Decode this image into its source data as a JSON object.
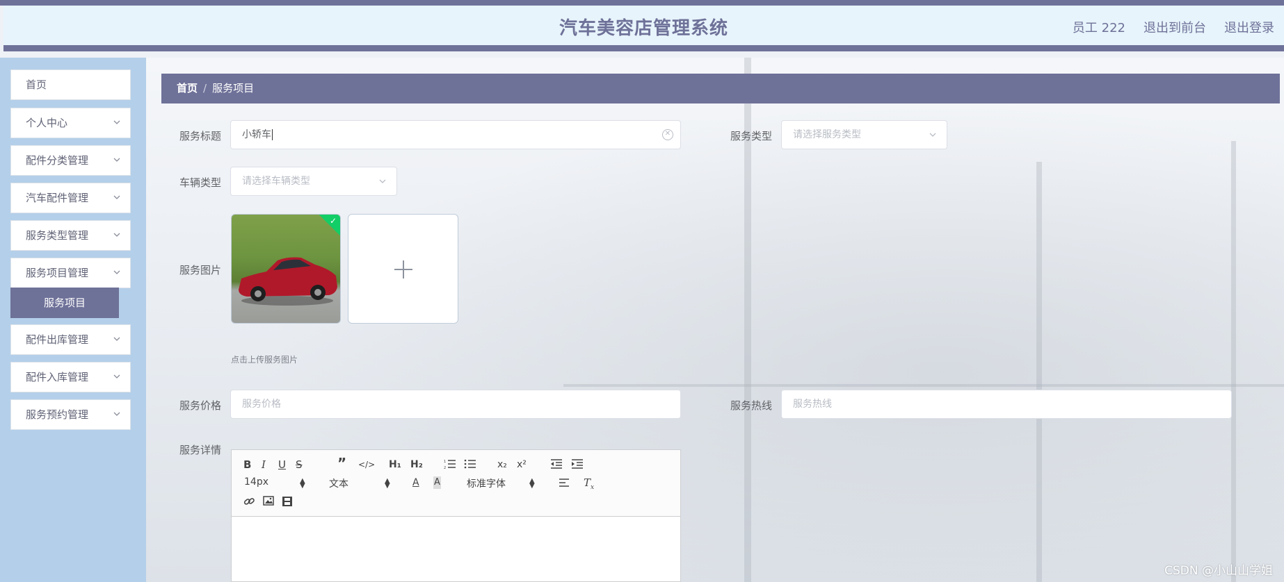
{
  "header": {
    "title": "汽车美容店管理系统",
    "user": "员工 222",
    "to_front": "退出到前台",
    "logout": "退出登录"
  },
  "sidebar": {
    "items": [
      {
        "label": "首页"
      },
      {
        "label": "个人中心"
      },
      {
        "label": "配件分类管理"
      },
      {
        "label": "汽车配件管理"
      },
      {
        "label": "服务类型管理"
      },
      {
        "label": "服务项目管理"
      },
      {
        "label": "配件出库管理"
      },
      {
        "label": "配件入库管理"
      },
      {
        "label": "服务预约管理"
      }
    ],
    "active_sub": "服务项目"
  },
  "breadcrumb": {
    "home": "首页",
    "separator": "/",
    "current": "服务项目"
  },
  "form": {
    "title_label": "服务标题",
    "title_value": "小轿车",
    "service_type_label": "服务类型",
    "service_type_placeholder": "请选择服务类型",
    "vehicle_type_label": "车辆类型",
    "vehicle_type_placeholder": "请选择车辆类型",
    "image_label": "服务图片",
    "image_hint": "点击上传服务图片",
    "price_label": "服务价格",
    "price_placeholder": "服务价格",
    "hotline_label": "服务热线",
    "hotline_placeholder": "服务热线",
    "detail_label": "服务详情"
  },
  "editor": {
    "size": "14px",
    "header": "文本",
    "font": "标准字体"
  },
  "watermark": "CSDN @小山山学姐",
  "colors": {
    "primary": "#6e7198",
    "sidebar_bg": "#b4cfe9",
    "header_bg": "#e7f4fb",
    "success": "#13ce66"
  }
}
